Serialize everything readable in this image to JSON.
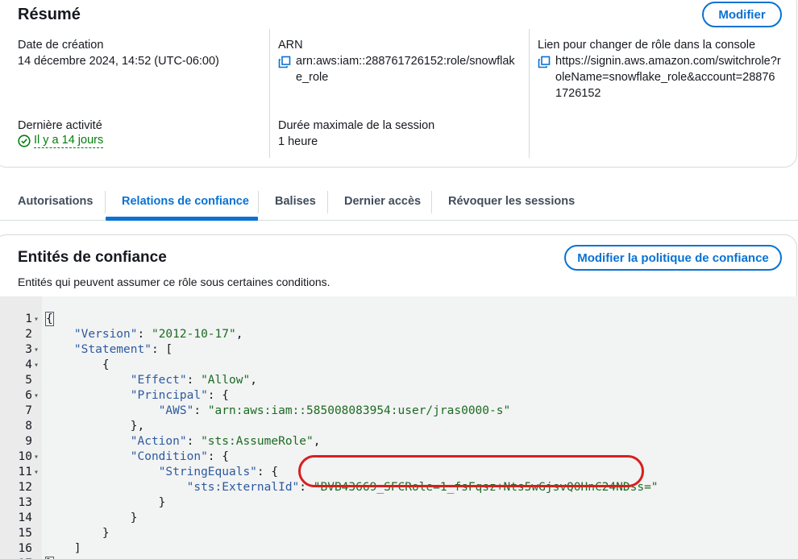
{
  "summary": {
    "title": "Résumé",
    "edit_button": "Modifier",
    "creation_label": "Date de création",
    "creation_value": "14 décembre 2024, 14:52 (UTC-06:00)",
    "last_activity_label": "Dernière activité",
    "last_activity_value": "Il y a 14 jours",
    "arn_label": "ARN",
    "arn_value": "arn:aws:iam::288761726152:role/snowflake_role",
    "max_session_label": "Durée maximale de la session",
    "max_session_value": "1 heure",
    "switch_role_label": "Lien pour changer de rôle dans la console",
    "switch_role_value": "https://signin.aws.amazon.com/switchrole?roleName=snowflake_role&account=288761726152"
  },
  "tabs": [
    {
      "label": "Autorisations"
    },
    {
      "label": "Relations de confiance"
    },
    {
      "label": "Balises"
    },
    {
      "label": "Dernier accès"
    },
    {
      "label": "Révoquer les sessions"
    }
  ],
  "trust": {
    "title": "Entités de confiance",
    "description": "Entités qui peuvent assumer ce rôle sous certaines conditions.",
    "edit_button": "Modifier la politique de confiance"
  },
  "policy": {
    "version_key": "\"Version\"",
    "version_value": "\"2012-10-17\"",
    "statement_key": "\"Statement\"",
    "effect_key": "\"Effect\"",
    "effect_value": "\"Allow\"",
    "principal_key": "\"Principal\"",
    "aws_key": "\"AWS\"",
    "aws_value": "\"arn:aws:iam::585008083954:user/jras0000-s\"",
    "action_key": "\"Action\"",
    "action_value": "\"sts:AssumeRole\"",
    "condition_key": "\"Condition\"",
    "stringequals_key": "\"StringEquals\"",
    "externalid_key": "\"sts:ExternalId\"",
    "externalid_value": "\"BVB43669_SFCRole=1_fsFqsz+Nts5wGjsvQ0HnC24NDss=\""
  },
  "colors": {
    "accent": "#0972d3",
    "success": "#037f0c",
    "highlight": "#d6201f",
    "json_key": "#2c5aa0",
    "json_string": "#1c6b22"
  }
}
